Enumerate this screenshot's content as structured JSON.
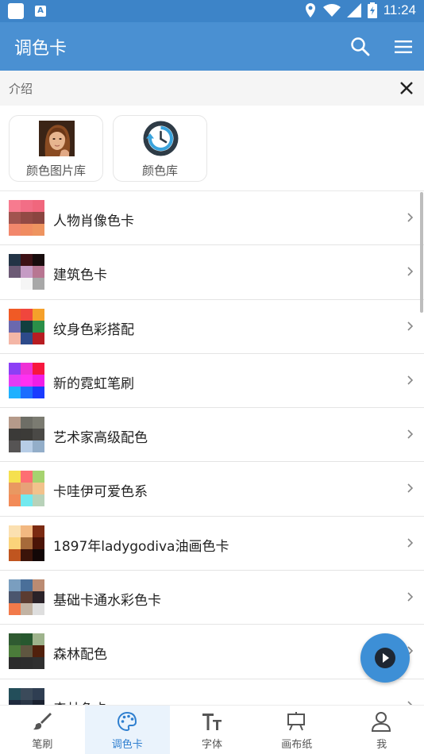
{
  "status_bar": {
    "time": "11:24"
  },
  "app_bar": {
    "title": "调色卡",
    "icons": [
      "search-icon",
      "menu-icon"
    ]
  },
  "intro_bar": {
    "label": "介绍",
    "close_icon": "close-icon"
  },
  "quick_cards": [
    {
      "label": "颜色图片库",
      "icon": "portrait-thumbnail"
    },
    {
      "label": "颜色库",
      "icon": "history-icon"
    }
  ],
  "palettes": [
    {
      "name": "人物肖像色卡",
      "colors": [
        "#f77b8f",
        "#f26e86",
        "#f0677d",
        "#a1544f",
        "#924a45",
        "#8a4540",
        "#f2876c",
        "#f08c61",
        "#ee9460"
      ]
    },
    {
      "name": "建筑色卡",
      "colors": [
        "#233446",
        "#3e1216",
        "#180c0d",
        "#6c5a75",
        "#c59bc4",
        "#b87692",
        "#ffffff",
        "#f5f5f5",
        "#a8a8a8"
      ]
    },
    {
      "name": "纹身色彩搭配",
      "colors": [
        "#f05a25",
        "#f0463d",
        "#f5a02a",
        "#6a68ae",
        "#123f3f",
        "#2a8f48",
        "#f4b6a6",
        "#2d4a8a",
        "#b71d22"
      ]
    },
    {
      "name": "新的霓虹笔刷",
      "colors": [
        "#8c3ff5",
        "#ee31d5",
        "#f7173e",
        "#e23df5",
        "#ff30f2",
        "#f01ee6",
        "#1fb1ff",
        "#1c6dff",
        "#1a3bff"
      ]
    },
    {
      "name": "艺术家高级配色",
      "colors": [
        "#b59a8a",
        "#6e6e66",
        "#7b7b71",
        "#3b3a38",
        "#3c3b38",
        "#4a4946",
        "#565454",
        "#b7cde6",
        "#93aec9"
      ]
    },
    {
      "name": "卡哇伊可爱色系",
      "colors": [
        "#f5e04f",
        "#fd6e73",
        "#a6d36f",
        "#e99861",
        "#e7a278",
        "#f2c28c",
        "#f28b58",
        "#72e9ef",
        "#b8d2b9"
      ]
    },
    {
      "name": "1897年ladygodiva油画色卡",
      "colors": [
        "#fbe0b1",
        "#f2b881",
        "#7b2a12",
        "#fbd37a",
        "#a66a3a",
        "#4b1407",
        "#c0551f",
        "#3b140a",
        "#120707"
      ]
    },
    {
      "name": "基础卡通水彩色卡",
      "colors": [
        "#7a9ebf",
        "#4a6f99",
        "#bb8b72",
        "#4b566e",
        "#5b3c31",
        "#2a2228",
        "#f27a4a",
        "#c2b3a3",
        "#dedede"
      ]
    },
    {
      "name": "森林配色",
      "colors": [
        "#2f5a31",
        "#27582f",
        "#9eb38c",
        "#4b7b3a",
        "#5f5640",
        "#51200c",
        "#2b2b2b",
        "#2d2d2d",
        "#303030"
      ]
    },
    {
      "name": "森林色卡",
      "colors": [
        "#234e5a",
        "#3b4a5a",
        "#2f3e52",
        "#1f2a3e",
        "#2a3646",
        "#1b2230",
        "#101010",
        "#121212",
        "#151515"
      ]
    }
  ],
  "bottom_nav": [
    {
      "label": "笔刷",
      "icon": "brush-icon",
      "active": false
    },
    {
      "label": "调色卡",
      "icon": "palette-icon",
      "active": true
    },
    {
      "label": "字体",
      "icon": "font-icon",
      "active": false
    },
    {
      "label": "画布纸",
      "icon": "easel-icon",
      "active": false
    },
    {
      "label": "我",
      "icon": "person-icon",
      "active": false
    }
  ],
  "fab": {
    "icon": "play-icon"
  },
  "colors": {
    "primary": "#4a90d2",
    "status_bar": "#3d84c8",
    "fab": "#3d8fd6",
    "active_tab": "#2f7fcf"
  }
}
